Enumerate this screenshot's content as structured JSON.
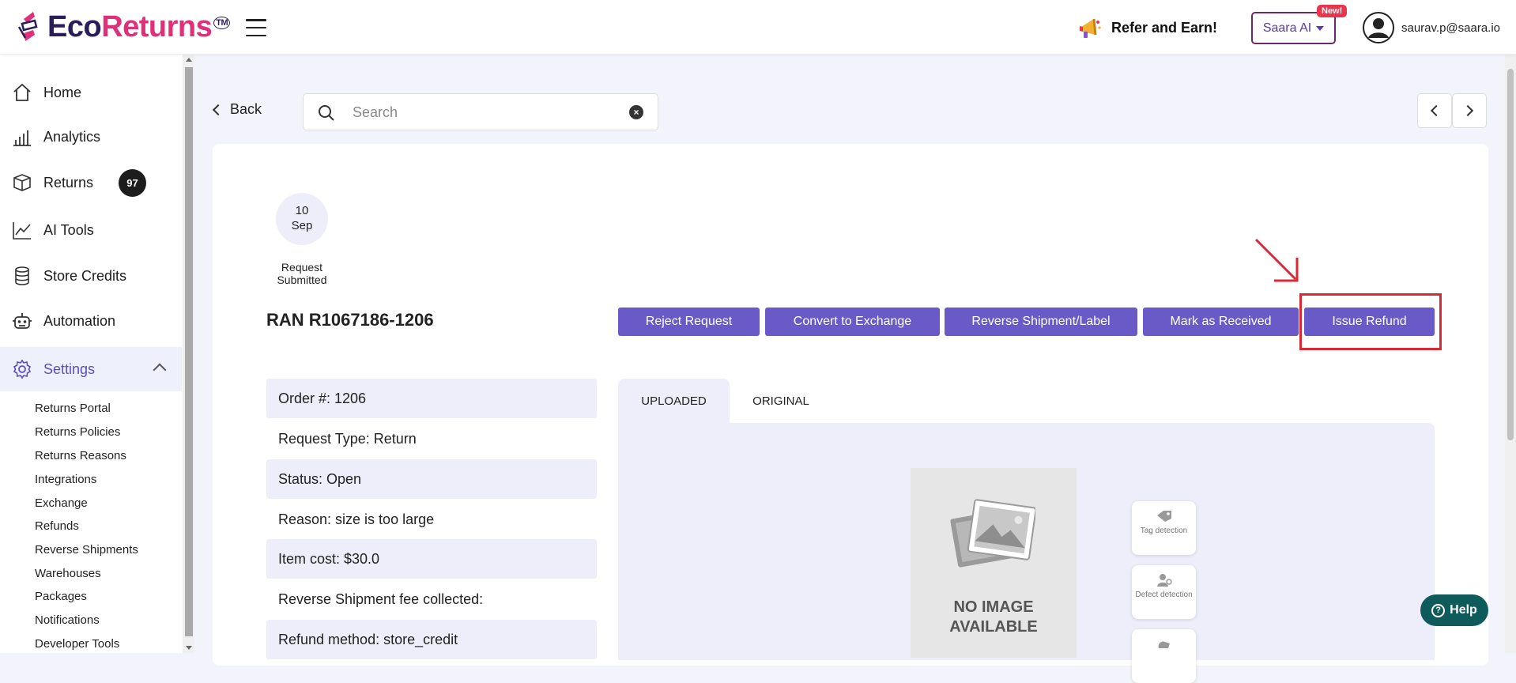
{
  "header": {
    "logo_eco": "Eco",
    "logo_returns": "Returns",
    "logo_tm": "TM",
    "refer_label": "Refer and Earn!",
    "saara_label": "Saara AI",
    "new_badge": "New!",
    "user_email": "saurav.p@saara.io"
  },
  "sidebar": {
    "items": [
      {
        "label": "Home",
        "icon": "home-icon"
      },
      {
        "label": "Analytics",
        "icon": "analytics-icon"
      },
      {
        "label": "Returns",
        "icon": "box-icon",
        "badge": "97"
      },
      {
        "label": "AI Tools",
        "icon": "trend-icon"
      },
      {
        "label": "Store Credits",
        "icon": "database-icon"
      },
      {
        "label": "Automation",
        "icon": "robot-icon"
      }
    ],
    "settings_label": "Settings",
    "settings_sub": [
      "Returns Portal",
      "Returns Policies",
      "Returns Reasons",
      "Integrations",
      "Exchange",
      "Refunds",
      "Reverse Shipments",
      "Warehouses",
      "Packages",
      "Notifications",
      "Developer Tools"
    ]
  },
  "toolbar": {
    "back_label": "Back",
    "search_placeholder": "Search",
    "search_value": ""
  },
  "timeline": {
    "day": "10",
    "month": "Sep",
    "status": "Request Submitted"
  },
  "request": {
    "ran": "RAN R1067186-1206",
    "actions": [
      "Reject Request",
      "Convert to Exchange",
      "Reverse Shipment/Label",
      "Mark as Received",
      "Issue Refund"
    ],
    "highlight_color": "#d82a35",
    "button_color": "#6a5ac8",
    "details": [
      "Order #: 1206",
      "Request Type: Return",
      "Status: Open",
      "Reason: size is too large",
      "Item cost: $30.0",
      "Reverse Shipment fee collected:",
      "Refund method: store_credit"
    ]
  },
  "media": {
    "tabs": [
      "UPLOADED",
      "ORIGINAL"
    ],
    "no_image_line1": "NO IMAGE",
    "no_image_line2": "AVAILABLE",
    "features": [
      "Tag detection",
      "Defect detection"
    ]
  },
  "help": {
    "label": "Help"
  }
}
